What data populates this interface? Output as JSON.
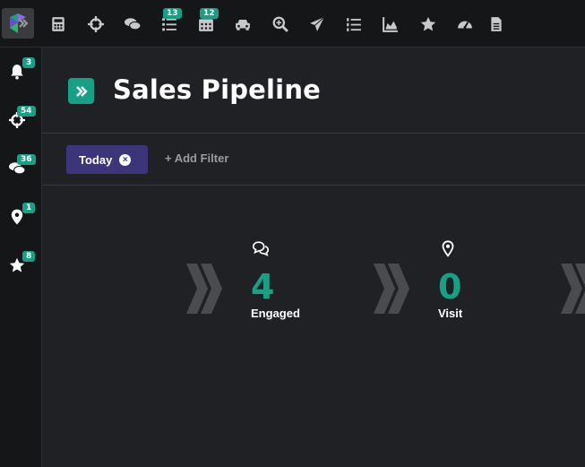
{
  "topbar": {
    "icons": [
      {
        "name": "calculator-icon"
      },
      {
        "name": "crosshairs-icon"
      },
      {
        "name": "comments-icon"
      },
      {
        "name": "list-icon",
        "badge": "13"
      },
      {
        "name": "calendar-icon",
        "badge": "12"
      },
      {
        "name": "car-icon"
      },
      {
        "name": "search-plus-icon"
      },
      {
        "name": "paper-plane-icon"
      },
      {
        "name": "list-ol-icon"
      },
      {
        "name": "chart-area-icon"
      },
      {
        "name": "star-icon"
      },
      {
        "name": "tachometer-icon"
      },
      {
        "name": "file-icon"
      }
    ]
  },
  "sidebar": {
    "items": [
      {
        "name": "bell-icon",
        "badge": "3"
      },
      {
        "name": "crosshairs-icon",
        "badge": "54"
      },
      {
        "name": "comments-icon",
        "badge": "36"
      },
      {
        "name": "map-marker-icon",
        "badge": "1"
      },
      {
        "name": "star-icon",
        "badge": "8"
      }
    ]
  },
  "header": {
    "title": "Sales Pipeline"
  },
  "filters": {
    "chip_label": "Today",
    "chip_close": "×",
    "add_filter": "+ Add Filter"
  },
  "pipeline": {
    "stages": [
      {
        "label": "Engaged",
        "count": "4",
        "icon": "comments-icon"
      },
      {
        "label": "Visit",
        "count": "0",
        "icon": "map-marker-icon"
      }
    ]
  },
  "colors": {
    "accent": "#16a085",
    "chip": "#3d3579",
    "background": "#202124",
    "bar": "#151618"
  }
}
